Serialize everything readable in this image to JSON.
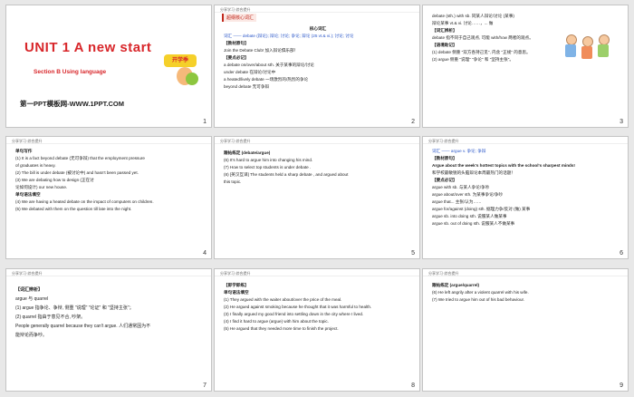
{
  "slides": [
    {
      "number": "1",
      "title": "UNIT 1  A new start",
      "subtitle": "Section B  Using language",
      "site": "第一PPT模板网-WWW.1PPT.COM",
      "badge_text": "开学季"
    },
    {
      "number": "2",
      "header": "分享学习·综合提升",
      "tag": "超纲核心词汇",
      "section_title": "核心词汇",
      "keyword_row": "词汇 —— debate (辩论); 辩论; 讨论; 争论; 辩论 (25 vt.& vi.); 讨论; 讨论",
      "lines": [
        "【教材原句】",
        "Join the Debate Club! 加入辩论俱乐部！",
        "【要点必记】",
        "a debate on/over/about sth. 关于某事的辩论/讨论",
        "under debate 在辩论/讨论中",
        "a heated/lively debate 一场激烈的/热烈的争论",
        "beyond debate 无可争辩"
      ]
    },
    {
      "number": "3",
      "lines": [
        "debate (sth.) with sb. 同某人辩论/讨论 (某事)",
        "      辩论某事 vt.& vi. 讨论……，... 做",
        "【词汇辨析】",
        "debate 指不同于自己观点, 可能 with/how 两者的观点。",
        "【语境助记】",
        "(1) debate 侧重 \"双方各持己见\", 内含 \"正规\" 的意思。",
        "(2) argue 侧重 \"说理\" \"争论\" 和 \"坚持主张\"。"
      ]
    },
    {
      "number": "4",
      "header": "分享学习·综合提升",
      "lines": [
        "单句写作",
        "(1) It is a fact  beyond  debate  (无可争辩) that the employment pressure",
        "of graduates is heavy.",
        "(2) The bill is  under  debate  (被讨论中) and hasn't been passed yet.",
        "(3) We  are  debating  how  to  design  (正在讨",
        "论如何设计) our new house.",
        "单句语法填空",
        "(4) We are having a heated debate  on  the impact of computers on children.",
        "(5) We debated  with  them on the question till late into the night."
      ]
    },
    {
      "number": "5",
      "header": "分享学习·综合提升",
      "lines": [
        "跟帖练定 (debate/argue)",
        "(6) It's hard to  argue  him into changing his mind.",
        "(7) How to select top students is under  debate  .",
        "(8) [英汉互译] The students held a sharp  debate  , and  argued  about",
        "this topic."
      ]
    },
    {
      "number": "6",
      "header": "分享学习·综合提升",
      "lines": [
        "词汇 —— argue v. 争论; 争辩",
        "【教材原句】",
        "Argue about the week's hottest topics with the school's sharpest minds!",
        "和学校最敏锐的头脑辩论本周最热门的话题！",
        "【要点必记】",
        "argue with sb. 与某人争论/争吵",
        "argue about/over sth. 为某事争论/争吵",
        "argue that... 主张/认为……",
        "argue for/against (doing) sth. 据理力争/反对 (做) 某事",
        "argue sb. into doing sth. 说服某人做某事",
        "argue sb. out of doing sth. 说服某人不做某事"
      ]
    },
    {
      "number": "7",
      "header": "分享学习·综合提升",
      "lines": [
        "【词汇辨析】",
        "argue 与 quarrel",
        "(1) argue 指争论、争辩, 侧重 \"说理\" \"论证\" 和 \"坚持主张\"；",
        "(2) quarrel 指由于意见不合, 吵架。",
        "People generally quarrel because they can't argue. 人们通常因为不",
        "能辩论而争吵。"
      ]
    },
    {
      "number": "8",
      "header": "分享学习·综合提升",
      "lines": [
        "【即学即练】",
        "单句语法填空",
        "(1) They argued  with  the waiter  about/over  the price of the meal.",
        "(2) He argued  against  smoking because he thought that it was harmful to health.",
        "(3) I finally argued my good friend  into  settling down in the city where I lived.",
        "(4) I find it hard  to argue  (argue) with him about the topic.",
        "(5) He argued  that  they needed more time to finish the project."
      ]
    },
    {
      "number": "9",
      "header": "分享学习·综合提升",
      "lines": [
        "跟帖练定 (argue/quarrel)",
        "(6) He left angrily after a violent  quarrel  with his wife.",
        "(7) We tried to  argue  him out of his bad behaviour."
      ]
    }
  ]
}
